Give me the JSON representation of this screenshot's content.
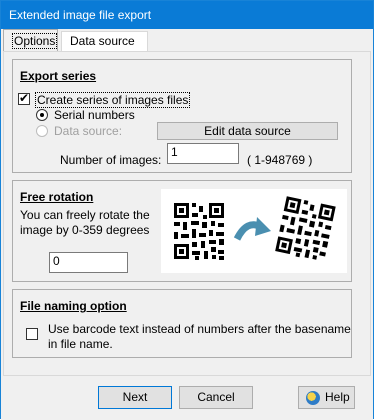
{
  "window": {
    "title": "Extended image file export"
  },
  "tabs": [
    {
      "label": "Options"
    },
    {
      "label": "Data source"
    }
  ],
  "export_series": {
    "title": "Export series",
    "create_series_label": "Create series of images files",
    "serial_numbers_label": "Serial numbers",
    "data_source_label": "Data source:",
    "edit_button_label": "Edit data source",
    "num_images_label": "Number of images:",
    "num_images_value": "1",
    "range_text": "( 1-948769 )"
  },
  "free_rotation": {
    "title": "Free rotation",
    "desc_line1": "You can freely rotate the",
    "desc_line2": "image by 0-359 degrees",
    "value": "0"
  },
  "file_naming": {
    "title": "File naming option",
    "option_line1": "Use barcode text instead of numbers after the basename",
    "option_line2": "in file name."
  },
  "buttons": {
    "next": "Next",
    "cancel": "Cancel",
    "help": "Help"
  },
  "colors": {
    "titlebar": "#0a7bd6",
    "arrow": "#4a8fb0"
  }
}
